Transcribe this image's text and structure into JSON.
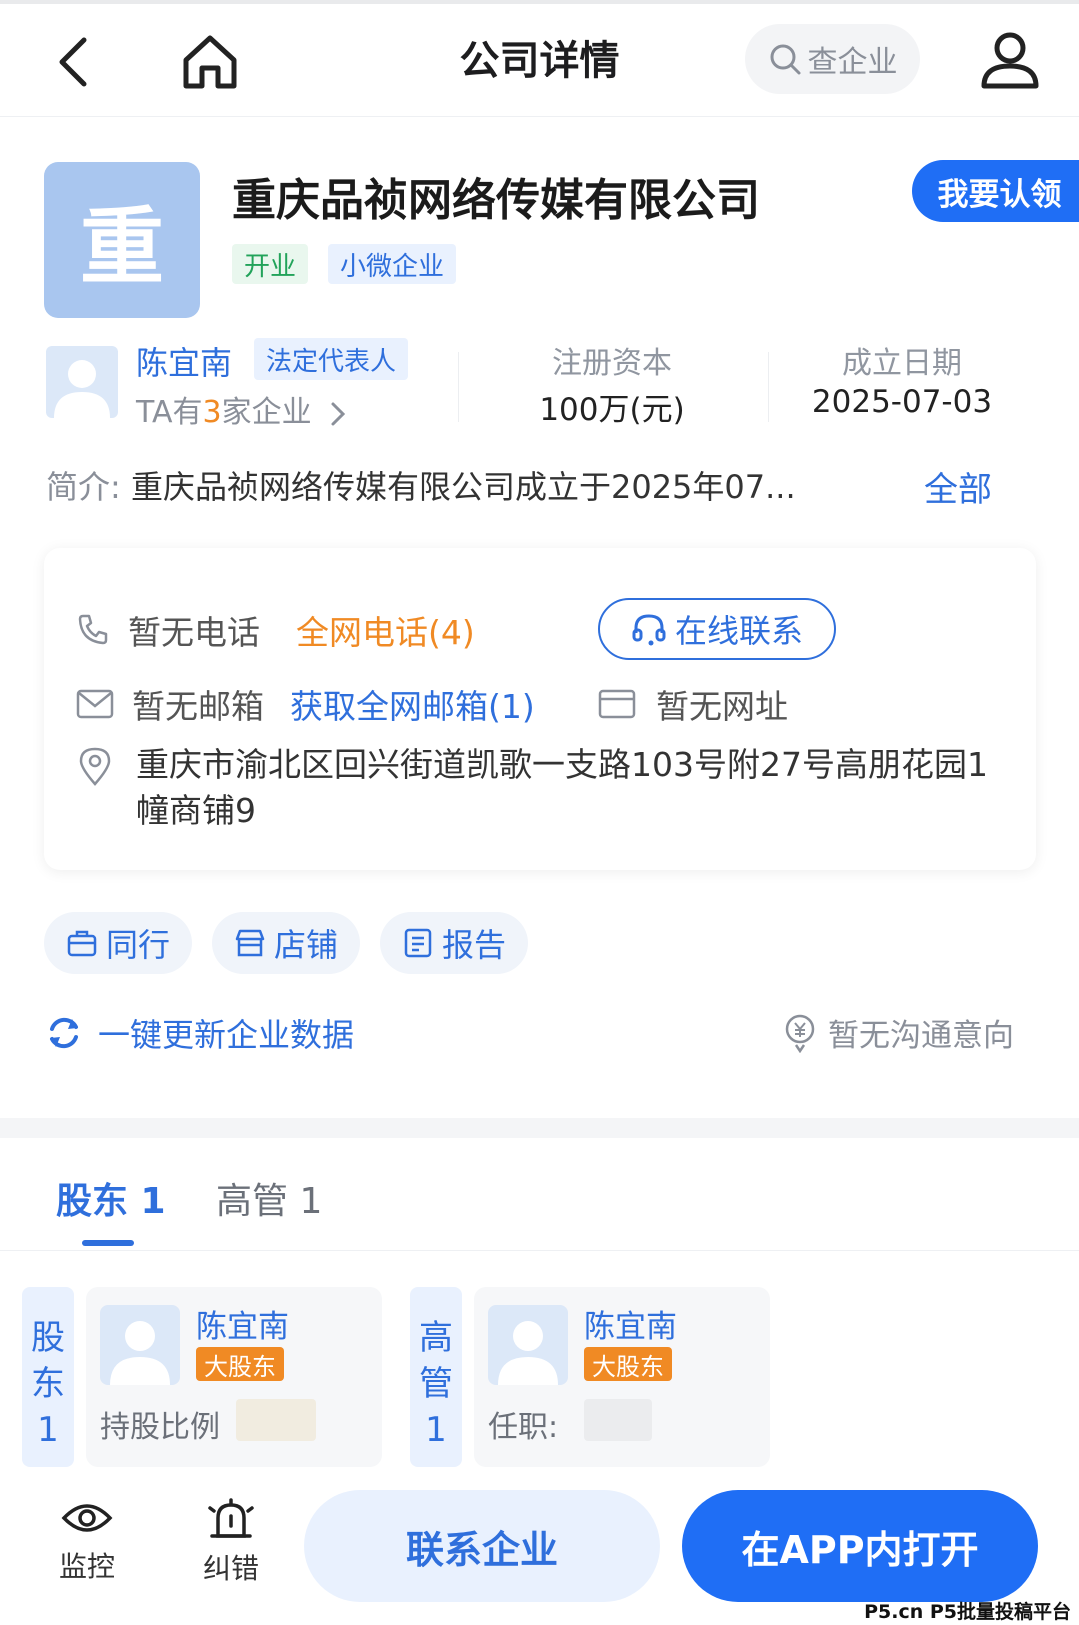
{
  "header": {
    "title": "公司详情",
    "search_label": "查企业"
  },
  "company": {
    "logo_char": "重",
    "name": "重庆品祯网络传媒有限公司",
    "claim_label": "我要认领",
    "tags": [
      "开业",
      "小微企业"
    ]
  },
  "legal_rep": {
    "name": "陈宜南",
    "badge": "法定代表人",
    "ent_prefix": "TA有",
    "ent_count": "3",
    "ent_suffix": "家企业"
  },
  "stats": [
    {
      "label": "注册资本",
      "value": "100万(元)"
    },
    {
      "label": "成立日期",
      "value": "2025-07-03"
    }
  ],
  "intro": {
    "label": "简介:",
    "text": "重庆品祯网络传媒有限公司成立于2025年07...",
    "more": "全部"
  },
  "contact": {
    "phone_none": "暂无电话",
    "phone_all": "全网电话(4)",
    "online": "在线联系",
    "email_none": "暂无邮箱",
    "email_get": "获取全网邮箱(1)",
    "web_none": "暂无网址",
    "address": "重庆市渝北区回兴街道凯歌一支路103号附27号高朋花园1幢商铺9"
  },
  "chips": [
    "同行",
    "店铺",
    "报告"
  ],
  "refresh_label": "一键更新企业数据",
  "intent_label": "暂无沟通意向",
  "tabs": [
    {
      "label": "股东 1",
      "active": true
    },
    {
      "label": "高管 1",
      "active": false
    }
  ],
  "people": [
    {
      "section": "股东1",
      "name": "陈宜南",
      "badge": "大股东",
      "field": "持股比例"
    },
    {
      "section": "高管1",
      "name": "陈宜南",
      "badge": "大股东",
      "field": "任职:"
    }
  ],
  "bottom": {
    "monitor": "监控",
    "correct": "纠错",
    "contact_btn": "联系企业",
    "app_btn": "在APP内打开"
  },
  "watermark": "P5.cn P5批量投稿平台",
  "colors": {
    "primary": "#1f6ef5",
    "link": "#2f6fdc",
    "orange": "#f08a24",
    "green": "#22a35a"
  }
}
